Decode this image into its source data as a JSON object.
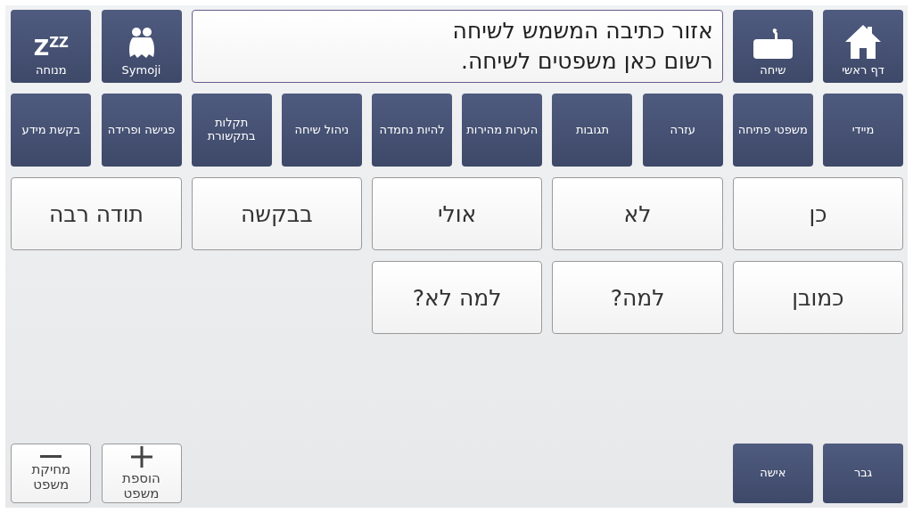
{
  "nav_right": [
    {
      "label": "דף ראשי",
      "kind": "home"
    },
    {
      "label": "שיחה",
      "kind": "chat"
    }
  ],
  "writing_area": {
    "lines": [
      "אזור כתיבה המשמש לשיחה",
      "רשום כאן משפטים לשיחה."
    ]
  },
  "nav_left": [
    {
      "label": "Symoji",
      "kind": "symoji"
    },
    {
      "label": "מנוחה",
      "kind": "sleep",
      "icon_text": "Z$^{Z}$$^{Z}$"
    }
  ],
  "categories": [
    "מיידי",
    "משפטי פתיחה",
    "עזרה",
    "תגובות",
    "הערות מהירות",
    "להיות נחמדה",
    "ניהול שיחה",
    "תקלות בתקשורת",
    "פגישה ופרידה",
    "בקשת מידע"
  ],
  "phrases": [
    "כן",
    "לא",
    "אולי",
    "בבקשה",
    "תודה רבה",
    "כמובן",
    "למה?",
    "למה לא?"
  ],
  "genders": [
    "גבר",
    "אישה"
  ],
  "sentence_actions": [
    {
      "label": "הוספת משפט",
      "kind": "add"
    },
    {
      "label": "מחיקת משפט",
      "kind": "remove"
    }
  ]
}
